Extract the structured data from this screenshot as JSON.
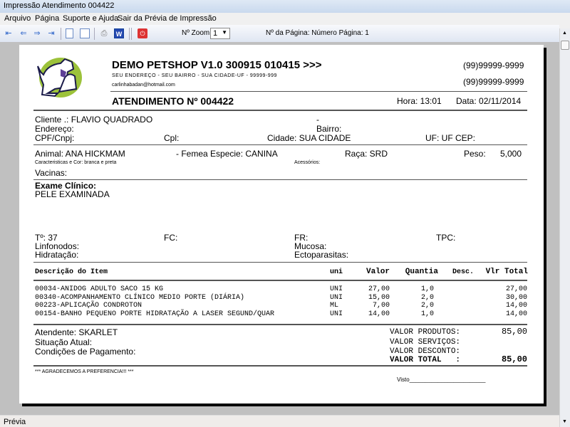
{
  "window": {
    "title": "Impressão Atendimento 004422"
  },
  "menu": [
    "Arquivo",
    "Página",
    "Suporte e Ajuda",
    "Sair da Prévia de Impressão"
  ],
  "toolbar": {
    "zoom_label": "Nº Zoom",
    "zoom_value": "1",
    "page_label": "Nº da Página: Número Página: 1"
  },
  "status": "Prévia",
  "report": {
    "company": "DEMO PETSHOP V1.0 300915 010415 >>>",
    "address": "SEU ENDEREÇO - SEU BAIRRO - SUA CIDADE-UF - 99999-999",
    "email": "carlinhabadan@hotmail.com",
    "phone1": "(99)99999-9999",
    "phone2": "(99)99999-9999",
    "title": "ATENDIMENTO Nº 004422",
    "hora": "Hora: 13:01",
    "data": "Data: 02/11/2014",
    "cliente": "Cliente   .: FLAVIO QUADRADO",
    "dash": "-",
    "endereco": "Endereço:",
    "bairro": "Bairro:",
    "cpf": "CPF/Cnpj:",
    "cpl": "Cpl:",
    "cidade": "Cidade: SUA CIDADE",
    "uf": "UF: UF  CEP:",
    "animal": "Animal: ANA HICKMAM",
    "sexo_especie": "- Femea  Especie: CANINA",
    "raca": "Raça: SRD",
    "peso_label": "Peso:",
    "peso": "5,000",
    "caracteristicas": "Caracteristicas e Cor: branca e preta",
    "acessorios": "Acessórios:",
    "vacinas": "Vacinas:",
    "exame_label": "Exame Clínico:",
    "exame": "PELE EXAMINADA",
    "temp": "Tº: 37",
    "fc": "FC:",
    "fr": "FR:",
    "tpc": "TPC:",
    "linfonodos": "Linfonodos:",
    "mucosa": "Mucosa:",
    "hidratacao": "Hidratação:",
    "ecto": "Ectoparasitas:",
    "columns": [
      "Descrição do Item",
      "uni",
      "Valor",
      "Quantia",
      "Desc.",
      "Vlr Total"
    ],
    "items": [
      {
        "desc": "00034-ANIDOG ADULTO SACO 15 KG",
        "uni": "UNI",
        "valor": "27,00",
        "qtd": "1,0",
        "desc_val": "",
        "total": "27,00"
      },
      {
        "desc": "00340-ACOMPANHAMENTO CLÍNICO MEDIO PORTE (DIÁRIA)",
        "uni": "UNI",
        "valor": "15,00",
        "qtd": "2,0",
        "desc_val": "",
        "total": "30,00"
      },
      {
        "desc": "00223-APLICAÇÃO CONDROTON",
        "uni": "ML",
        "valor": "7,00",
        "qtd": "2,0",
        "desc_val": "",
        "total": "14,00"
      },
      {
        "desc": "00154-BANHO PEQUENO PORTE HIDRATAÇÃO A LASER SEGUND/QUAR",
        "uni": "UNI",
        "valor": "14,00",
        "qtd": "1,0",
        "desc_val": "",
        "total": "14,00"
      }
    ],
    "atendente": "Atendente: SKARLET",
    "situacao": "Situação Atual:",
    "condicoes": "Condições de Pagamento:",
    "valor_produtos_label": "VALOR PRODUTOS:",
    "valor_produtos": "85,00",
    "valor_servicos_label": "VALOR SERVIÇOS:",
    "valor_desconto_label": "VALOR DESCONTO:",
    "valor_total_label": "VALOR TOTAL   :",
    "valor_total": "85,00",
    "agradecimento": "*** AGRADECEMOS A PREFERENCIA!!! ***",
    "visto": "Visto________________________"
  }
}
